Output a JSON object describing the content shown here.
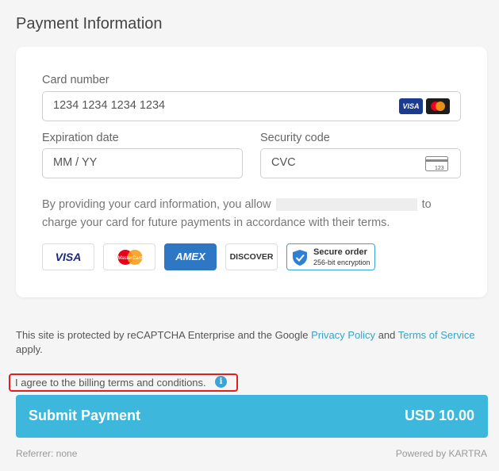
{
  "page": {
    "title": "Payment Information"
  },
  "card_form": {
    "card_number_label": "Card number",
    "card_number_placeholder": "1234 1234 1234 1234",
    "expiration_label": "Expiration date",
    "expiration_placeholder": "MM / YY",
    "security_label": "Security code",
    "security_placeholder": "CVC",
    "cvc_icon_text": "123",
    "mini_brands": [
      "VISA",
      "mastercard"
    ],
    "notice_part1": "By providing your card information, you allow",
    "notice_part2": "to charge your card for future payments in accordance with their terms."
  },
  "brands": {
    "visa": "VISA",
    "mastercard": "MasterCard",
    "amex": "AMEX",
    "discover": "DISCOVER",
    "secure_title": "Secure order",
    "secure_sub": "256-bit encryption"
  },
  "recaptcha": {
    "text1": "This site is protected by reCAPTCHA Enterprise and the Google",
    "privacy_link": "Privacy Policy",
    "and": "and",
    "terms_link": "Terms of Service",
    "text2": "apply."
  },
  "agreement": {
    "text": "I agree to the billing terms and conditions.",
    "info_icon": "i"
  },
  "submit": {
    "label": "Submit Payment",
    "amount": "USD 10.00"
  },
  "footer": {
    "referrer": "Referrer: none",
    "powered": "Powered by KARTRA"
  },
  "colors": {
    "accent": "#3db8dc",
    "link": "#3aa3c6",
    "highlight_border": "#e02020"
  }
}
